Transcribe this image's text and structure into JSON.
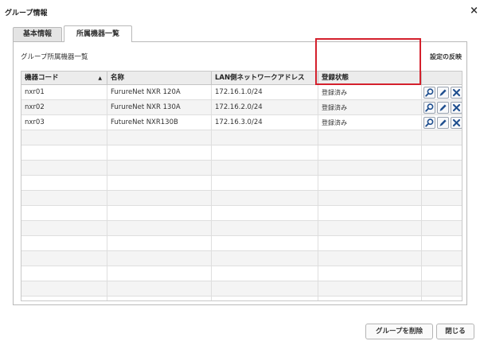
{
  "dialog": {
    "title": "グループ情報",
    "close_glyph": "×"
  },
  "tabs": [
    {
      "label": "基本情報"
    },
    {
      "label": "所属機器一覧"
    }
  ],
  "panel": {
    "list_title": "グループ所属機器一覧",
    "reflect_label": "設定の反映"
  },
  "table": {
    "headers": [
      "機器コード",
      "名称",
      "LAN側ネットワークアドレス",
      "登録状態"
    ],
    "sort_indicator": "▲",
    "rows": [
      {
        "code": "nxr01",
        "name": "FurureNet NXR 120A",
        "address": "172.16.1.0/24",
        "status": "登録済み"
      },
      {
        "code": "nxr02",
        "name": "FurureNet NXR 130A",
        "address": "172.16.2.0/24",
        "status": "登録済み"
      },
      {
        "code": "nxr03",
        "name": "FutureNet NXR130B",
        "address": "172.16.3.0/24",
        "status": "登録済み"
      }
    ],
    "row_actions": [
      "search-icon",
      "pencil-icon",
      "delete-x-icon"
    ]
  },
  "footer": {
    "delete_group_label": "グループを削除",
    "close_label": "閉じる"
  },
  "colors": {
    "highlight": "#d4202c",
    "action_blue": "#1f4f8f"
  }
}
